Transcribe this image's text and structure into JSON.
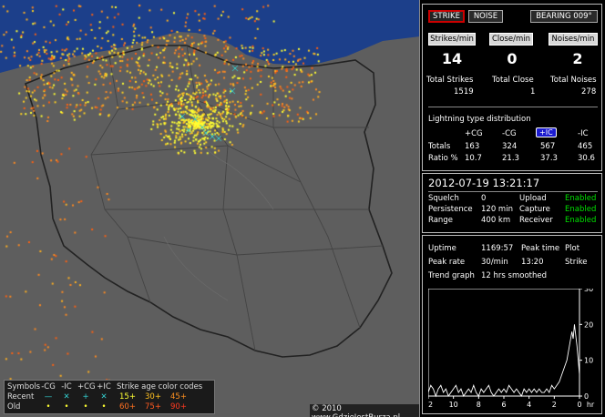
{
  "map": {
    "copyright": "© 2010 www.GdzieJestBurza.pl",
    "legend": {
      "symbols_label": "Symbols",
      "symbol_headers": [
        "-CG",
        "-IC",
        "+CG",
        "+IC"
      ],
      "recent_label": "Recent",
      "old_label": "Old",
      "recent_symbols": [
        "—",
        "✕",
        "+",
        "✕"
      ],
      "old_symbols": [
        "•",
        "•",
        "•",
        "•"
      ],
      "age_title": "Strike age color codes",
      "recent_ages": [
        "15+",
        "30+",
        "45+"
      ],
      "old_ages": [
        "60+",
        "75+",
        "90+"
      ]
    },
    "colors": {
      "land": "#5e5e5e",
      "sea": "#1c3f8a",
      "recent": "#ffff33",
      "old": "#ff6a10",
      "ic": "#33cccc"
    }
  },
  "panel_top": {
    "strike_button": "STRIKE",
    "noise_button": "NOISE",
    "bearing_button": "BEARING 009°",
    "rate_headers": [
      "Strikes/min",
      "Close/min",
      "Noises/min"
    ],
    "rate_values": [
      "14",
      "0",
      "2"
    ],
    "total_labels": [
      "Total Strikes",
      "Total Close",
      "Total Noises"
    ],
    "total_values": [
      "1519",
      "1",
      "278"
    ],
    "dist_title": "Lightning type distribution",
    "dist_headers": [
      "+CG",
      "-CG",
      "+IC",
      "-IC"
    ],
    "totals_label": "Totals",
    "totals_values": [
      "163",
      "324",
      "567",
      "465"
    ],
    "ratio_label": "Ratio %",
    "ratio_values": [
      "10.7",
      "21.3",
      "37.3",
      "30.6"
    ]
  },
  "panel_mid": {
    "datetime": "2012-07-19 13:21:17",
    "rows": [
      {
        "label": "Squelch",
        "value": "0",
        "label2": "Upload",
        "status": "Enabled"
      },
      {
        "label": "Persistence",
        "value": "120 min",
        "label2": "Capture",
        "status": "Enabled"
      },
      {
        "label": "Range",
        "value": "400 km",
        "label2": "Receiver",
        "status": "Enabled"
      }
    ]
  },
  "panel_bottom": {
    "uptime_label": "Uptime",
    "uptime_value": "1169:57",
    "peak_time_label": "Peak time",
    "plot_label": "Plot",
    "peak_rate_label": "Peak rate",
    "peak_rate_value": "30/min",
    "peak_time_value": "13:20",
    "plot_value": "Strike",
    "trend_label": "Trend graph",
    "trend_value": "12 hrs smoothed"
  },
  "chart_data": {
    "type": "line",
    "title": "",
    "xlabel": "hr",
    "ylabel": "",
    "x_ticks": [
      "12",
      "10",
      "8",
      "6",
      "4",
      "2",
      "0"
    ],
    "y_ticks": [
      "0",
      "10",
      "20",
      "30"
    ],
    "xlim": [
      12,
      0
    ],
    "ylim": [
      0,
      30
    ],
    "series": [
      {
        "x": [
          12,
          11.8,
          11.6,
          11.4,
          11.2,
          11,
          10.8,
          10.6,
          10.4,
          10.2,
          10,
          9.8,
          9.6,
          9.4,
          9.2,
          9,
          8.8,
          8.6,
          8.4,
          8.2,
          8,
          7.8,
          7.6,
          7.4,
          7.2,
          7,
          6.8,
          6.6,
          6.4,
          6.2,
          6,
          5.8,
          5.6,
          5.4,
          5.2,
          5,
          4.8,
          4.6,
          4.4,
          4.2,
          4,
          3.8,
          3.6,
          3.4,
          3.2,
          3,
          2.8,
          2.6,
          2.4,
          2.2,
          2,
          1.8,
          1.6,
          1.4,
          1.2,
          1.0,
          0.8,
          0.6,
          0.5,
          0.4,
          0.3,
          0.2,
          0.1,
          0
        ],
        "y": [
          1,
          3,
          2,
          0,
          2,
          3,
          1,
          2,
          0,
          1,
          2,
          3,
          1,
          2,
          0,
          1,
          2,
          1,
          3,
          1,
          0,
          2,
          1,
          2,
          3,
          1,
          0,
          1,
          2,
          1,
          2,
          1,
          3,
          2,
          1,
          2,
          1,
          0,
          2,
          1,
          2,
          1,
          2,
          1,
          2,
          1,
          1,
          2,
          1,
          3,
          2,
          3,
          4,
          6,
          8,
          10,
          14,
          18,
          16,
          20,
          17,
          14,
          10,
          6
        ]
      }
    ]
  }
}
